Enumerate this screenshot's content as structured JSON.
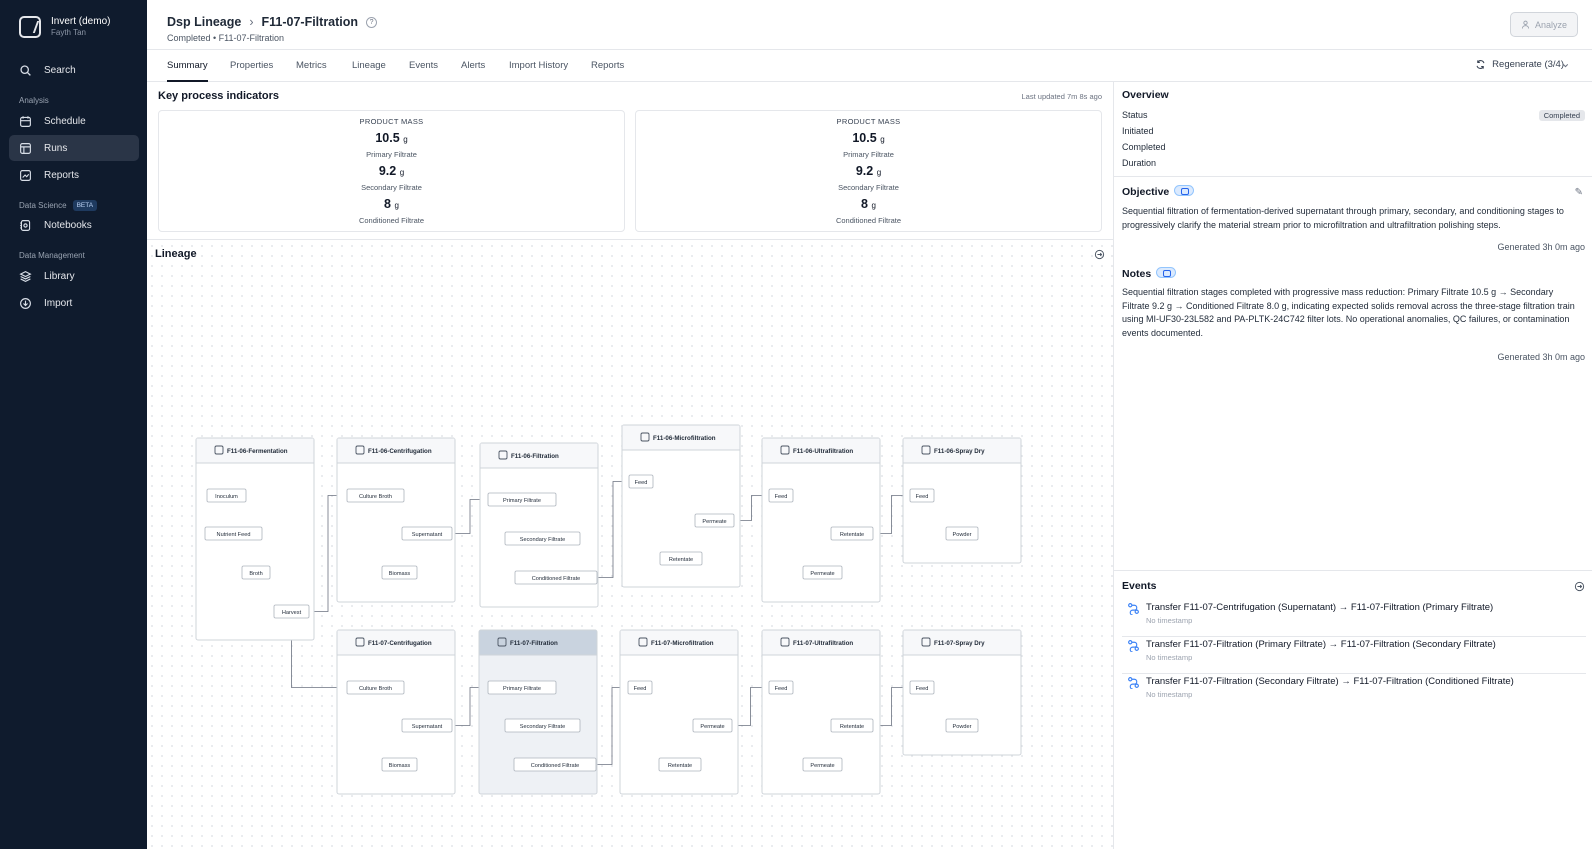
{
  "sidebar": {
    "org_name": "Invert (demo)",
    "user": "Fayth Tan",
    "search": "Search",
    "sections": {
      "analysis": "Analysis",
      "data_science": "Data Science",
      "data_management": "Data Management"
    },
    "beta": "BETA",
    "items": {
      "schedule": "Schedule",
      "runs": "Runs",
      "reports": "Reports",
      "notebooks": "Notebooks",
      "library": "Library",
      "import": "Import"
    }
  },
  "header": {
    "crumb_parent": "Dsp Lineage",
    "crumb_sep": "›",
    "title": "F11-07-Filtration",
    "subtitle": "Completed • F11-07-Filtration",
    "help": "?",
    "analyze": "Analyze"
  },
  "tabs": [
    "Summary",
    "Properties",
    "Metrics",
    "Lineage",
    "Events",
    "Alerts",
    "Import History",
    "Reports"
  ],
  "regenerate": "Regenerate (3/4)",
  "kpi": {
    "title": "Key process indicators",
    "updated": "Last updated 7m 8s ago",
    "cards": [
      {
        "heading": "PRODUCT MASS",
        "items": [
          {
            "value": "10.5",
            "unit": "g",
            "label": "Primary Filtrate"
          },
          {
            "value": "9.2",
            "unit": "g",
            "label": "Secondary Filtrate"
          },
          {
            "value": "8",
            "unit": "g",
            "label": "Conditioned Filtrate"
          }
        ]
      },
      {
        "heading": "PRODUCT MASS",
        "items": [
          {
            "value": "10.5",
            "unit": "g",
            "label": "Primary Filtrate"
          },
          {
            "value": "9.2",
            "unit": "g",
            "label": "Secondary Filtrate"
          },
          {
            "value": "8",
            "unit": "g",
            "label": "Conditioned Filtrate"
          }
        ]
      }
    ]
  },
  "lineage": {
    "title": "Lineage",
    "processes": {
      "f06_fermentation": "F11-06-Fermentation",
      "f06_centrifugation": "F11-06-Centrifugation",
      "f06_filtration": "F11-06-Filtration",
      "f06_microfiltration": "F11-06-Microfiltration",
      "f06_ultrafiltration": "F11-06-Ultrafiltration",
      "f06_spray_dry": "F11-06-Spray Dry",
      "f07_centrifugation": "F11-07-Centrifugation",
      "f07_filtration": "F11-07-Filtration",
      "f07_microfiltration": "F11-07-Microfiltration",
      "f07_ultrafiltration": "F11-07-Ultrafiltration",
      "f07_spray_dry": "F11-07-Spray Dry"
    },
    "materials": {
      "inoculum": "Inoculum",
      "nutrient_feed": "Nutrient Feed",
      "broth": "Broth",
      "harvest": "Harvest",
      "culture_broth": "Culture Broth",
      "supernatant": "Supernatant",
      "biomass": "Biomass",
      "primary_filtrate": "Primary Filtrate",
      "secondary_filtrate": "Secondary Filtrate",
      "conditioned_filtrate": "Conditioned Filtrate",
      "feed": "Feed",
      "permeate": "Permeate",
      "retentate": "Retentate",
      "powder": "Powder"
    }
  },
  "overview": {
    "title": "Overview",
    "status_label": "Status",
    "status_value": "Completed",
    "initiated": "Initiated",
    "completed": "Completed",
    "duration": "Duration"
  },
  "objective": {
    "title": "Objective",
    "text": "Sequential filtration of fermentation-derived supernatant through primary, secondary, and conditioning stages to progressively clarify the material stream prior to microfiltration and ultrafiltration polishing steps.",
    "generated": "Generated 3h 0m ago"
  },
  "notes": {
    "title": "Notes",
    "text": "Sequential filtration stages completed with progressive mass reduction: Primary Filtrate 10.5 g → Secondary Filtrate 9.2 g → Conditioned Filtrate 8.0 g, indicating expected solids removal across the three-stage filtration train using MI-UF30-23L582 and PA-PLTK-24C742 filter lots. No operational anomalies, QC failures, or contamination events documented.",
    "generated": "Generated 3h 0m ago"
  },
  "events": {
    "title": "Events",
    "items": [
      {
        "text": "Transfer F11-07-Centrifugation (Supernatant) → F11-07-Filtration (Primary Filtrate)",
        "sub": "No timestamp"
      },
      {
        "text": "Transfer F11-07-Filtration (Primary Filtrate) → F11-07-Filtration (Secondary Filtrate)",
        "sub": "No timestamp"
      },
      {
        "text": "Transfer F11-07-Filtration (Secondary Filtrate) → F11-07-Filtration (Conditioned Filtrate)",
        "sub": "No timestamp"
      }
    ]
  },
  "colors": {
    "sidebar": "#0f1b2d",
    "active_nav": "#2a3547",
    "accent": "#3b82f6",
    "selected_node": "#c9d3df"
  }
}
